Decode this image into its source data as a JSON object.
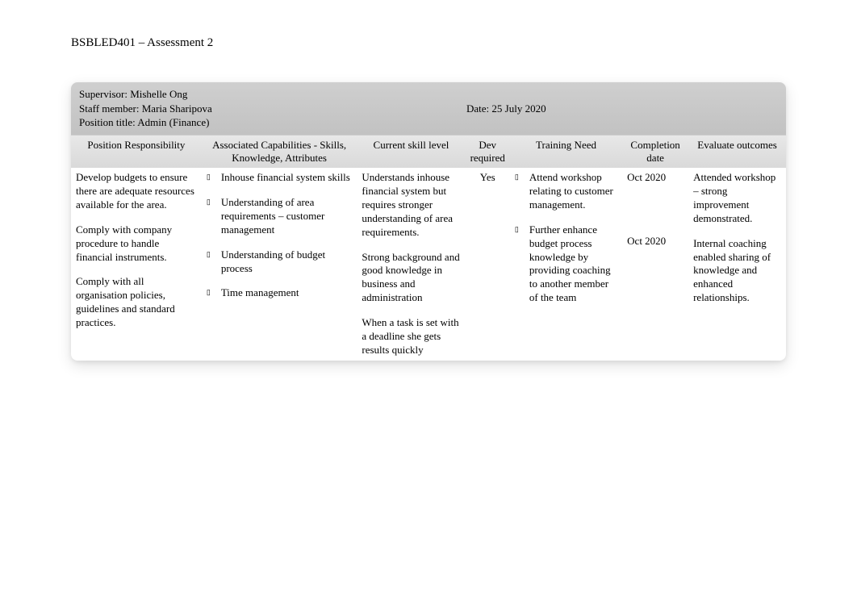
{
  "doc_title": "BSBLED401 – Assessment 2",
  "meta": {
    "supervisor_label": "Supervisor: ",
    "supervisor_value": "Mishelle Ong",
    "staff_label": "Staff member: ",
    "staff_value": "Maria Sharipova",
    "date_label": "Date: ",
    "date_value": "25 July 2020",
    "position_label": "Position title: ",
    "position_value": "Admin (Finance)"
  },
  "headers": {
    "responsibility": "Position Responsibility",
    "capabilities": "Associated Capabilities - Skills, Knowledge, Attributes",
    "skill_level": "Current skill level",
    "dev_required": "Dev required",
    "training_need": "Training Need",
    "completion_date": "Completion date",
    "evaluate": "Evaluate outcomes"
  },
  "row": {
    "responsibility": {
      "p1": "Develop budgets to ensure there are adequate resources available for the area.",
      "p2": "Comply with company procedure to handle financial instruments.",
      "p3": "Comply with all organisation policies, guidelines and standard practices."
    },
    "capabilities": {
      "b1": "Inhouse financial system skills",
      "b2": "Understanding of area requirements – customer management",
      "b3": "Understanding of budget process",
      "b4": "Time management"
    },
    "skill_level": {
      "p1": "Understands inhouse financial system but requires stronger understanding of area requirements.",
      "p2": "Strong background and good knowledge in business and administration",
      "p3": "When a task is set with a deadline she gets results quickly"
    },
    "dev_required": "Yes",
    "training_need": {
      "b1": "Attend workshop relating to customer management.",
      "b2": "Further enhance budget process knowledge by providing coaching to another member of the team"
    },
    "completion_date": {
      "d1": "Oct 2020",
      "d2": "Oct 2020"
    },
    "evaluate": {
      "e1": "Attended workshop – strong improvement demonstrated.",
      "e2": "Internal coaching enabled sharing of knowledge and enhanced relationships."
    }
  },
  "bullet_glyph": "▯"
}
